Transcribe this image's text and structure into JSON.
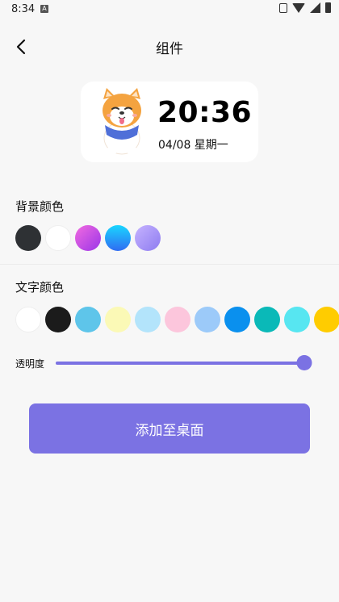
{
  "status_bar": {
    "time": "8:34",
    "notif_letter": "A",
    "icons": [
      "vibrate-icon",
      "wifi-icon",
      "signal-icon",
      "battery-icon"
    ]
  },
  "header": {
    "back_icon": "chevron-left-icon",
    "title": "组件"
  },
  "widget": {
    "mascot_icon": "shiba-dog-sticker",
    "time": "20:36",
    "date": "04/08 星期一"
  },
  "background_color": {
    "label": "背景颜色",
    "swatches": [
      {
        "color": "#2e3134"
      },
      {
        "color": "#ffffff"
      },
      {
        "color": "linear-gradient(135deg,#f26be0,#9a35e8)"
      },
      {
        "color": "linear-gradient(180deg,#1ad6ff,#2f6cf2)"
      },
      {
        "color": "linear-gradient(135deg,#c6b3ff,#8d7bf0)"
      }
    ]
  },
  "text_color": {
    "label": "文字颜色",
    "swatches": [
      {
        "color": "#ffffff"
      },
      {
        "color": "#1b1b1b"
      },
      {
        "color": "#5ec5ea"
      },
      {
        "color": "#fbf9b6"
      },
      {
        "color": "#b3e4fb"
      },
      {
        "color": "#fcc6dc"
      },
      {
        "color": "#9ccaf9"
      },
      {
        "color": "#0a90ee"
      },
      {
        "color": "#0ab9b8"
      },
      {
        "color": "#57e6f1"
      },
      {
        "color": "#ffcc00"
      }
    ]
  },
  "opacity": {
    "label": "透明度",
    "value": 1.0
  },
  "actions": {
    "add_label": "添加至桌面"
  },
  "colors": {
    "accent": "#7b72e3",
    "background": "#f7f7f7"
  }
}
